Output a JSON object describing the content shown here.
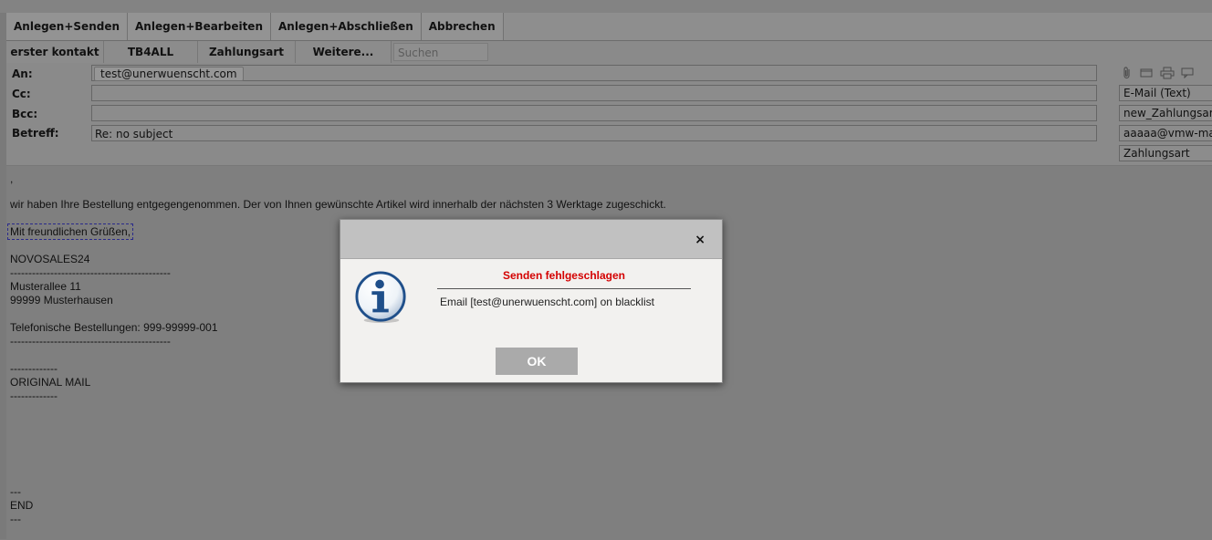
{
  "toolbar": {
    "buttons": [
      "Anlegen+Senden",
      "Anlegen+Bearbeiten",
      "Anlegen+Abschließen",
      "Abbrechen"
    ]
  },
  "tabs": {
    "items": [
      "erster kontakt",
      "TB4ALL",
      "Zahlungsart",
      "Weitere..."
    ],
    "search_placeholder": "Suchen"
  },
  "header": {
    "to_label": "An:",
    "cc_label": "Cc:",
    "bcc_label": "Bcc:",
    "subject_label": "Betreff:",
    "to_recipient": "test@unerwuenscht.com",
    "subject_value": "Re: no subject"
  },
  "right_panel": {
    "icons": [
      "paperclip-icon",
      "window-icon",
      "print-icon",
      "comment-icon"
    ],
    "format": "E-Mail (Text)",
    "template": "new_Zahlungsart",
    "sender": "aaaaa@vmw-mail",
    "category": "Zahlungsart"
  },
  "body": {
    "lines": [
      ",",
      "wir haben Ihre Bestellung entgegengenommen. Der von Ihnen gewünschte Artikel wird innerhalb der nächsten 3 Werktage zugeschickt.",
      "Mit freundlichen Grüßen,",
      "NOVOSALES24",
      "--------------------------------------------",
      "Musterallee 11",
      "99999 Musterhausen",
      "Telefonische Bestellungen: 999-99999-001",
      "--------------------------------------------",
      "-------------",
      "ORIGINAL MAIL",
      "-------------",
      "---",
      "END",
      "---"
    ]
  },
  "dialog": {
    "close_glyph": "×",
    "title": "Senden fehlgeschlagen",
    "message": "Email [test@unerwuenscht.com] on blacklist",
    "ok_label": "OK",
    "title_color": "#d40000"
  }
}
